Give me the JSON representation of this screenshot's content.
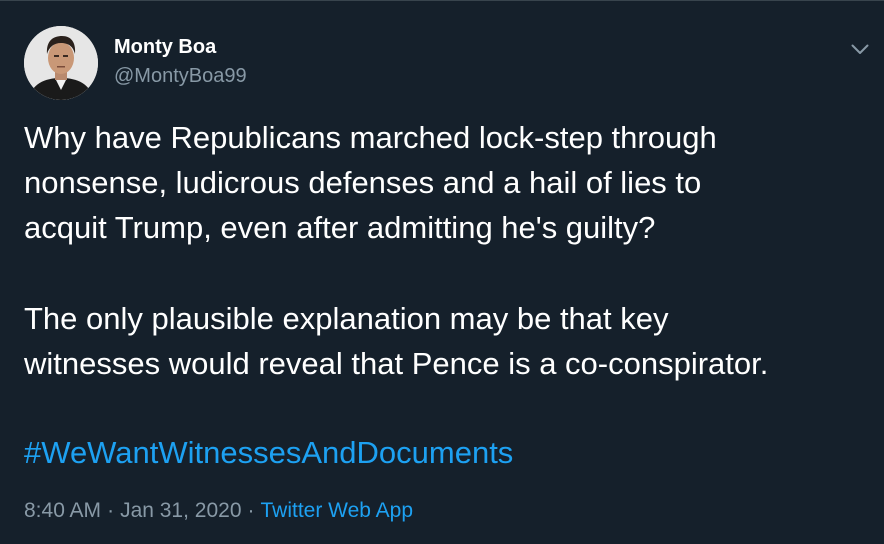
{
  "colors": {
    "background": "#15202b",
    "text": "#ffffff",
    "secondary_text": "#8899a6",
    "accent": "#1da1f2",
    "border": "#38444d"
  },
  "author": {
    "name": "Monty Boa",
    "handle": "@MontyBoa99",
    "avatar_icon": "profile-photo"
  },
  "menu": {
    "icon": "chevron-down-icon"
  },
  "tweet": {
    "paragraph1_lines": [
      "Why have Republicans marched lock-step through",
      "nonsense, ludicrous defenses and a hail of lies to",
      "acquit Trump, even after admitting he's guilty?"
    ],
    "paragraph2_lines": [
      "The only plausible explanation may be that key",
      "witnesses would reveal that Pence is a co-conspirator."
    ],
    "hashtag": "#WeWantWitnessesAndDocuments"
  },
  "meta": {
    "time": "8:40 AM",
    "separator": "·",
    "date": "Jan 31, 2020",
    "source": "Twitter Web App"
  }
}
